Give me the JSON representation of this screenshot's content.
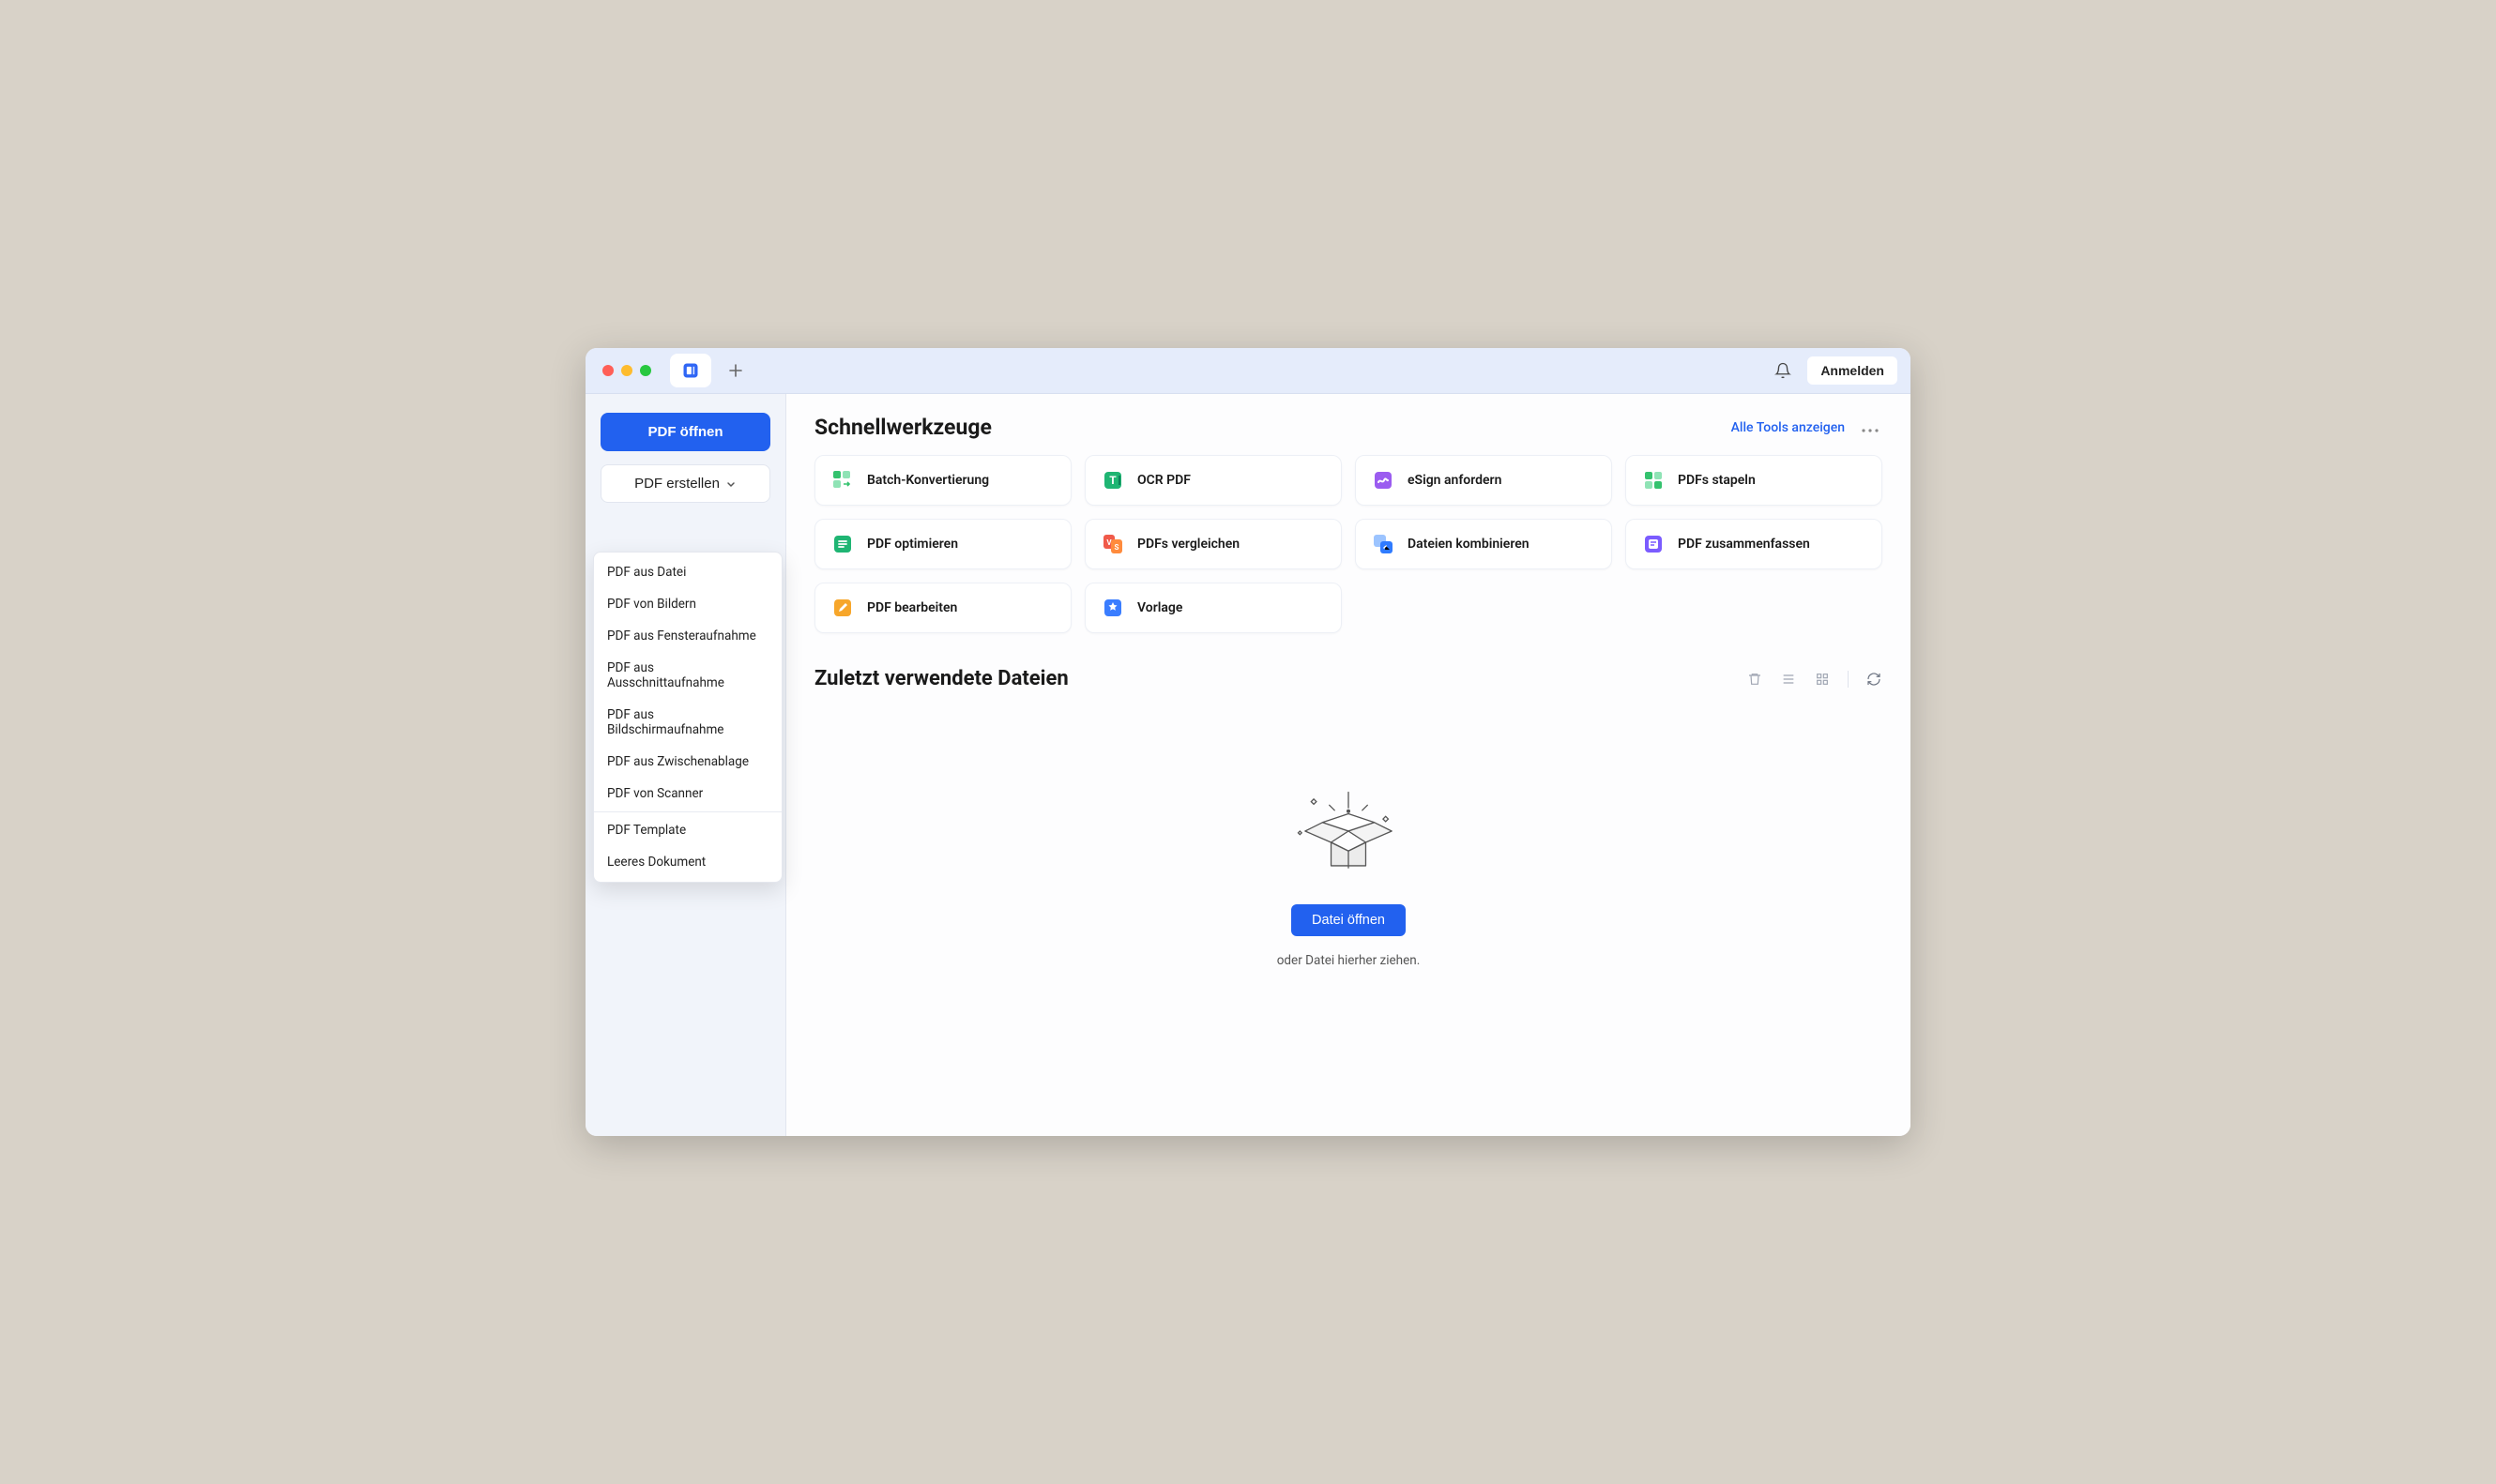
{
  "titlebar": {
    "login_label": "Anmelden"
  },
  "sidebar": {
    "open_pdf_label": "PDF öffnen",
    "create_pdf_label": "PDF erstellen",
    "create_menu": [
      "PDF aus Datei",
      "PDF von Bildern",
      "PDF aus Fensteraufnahme",
      "PDF aus Ausschnittaufnahme",
      "PDF aus Bildschirmaufnahme",
      "PDF aus Zwischenablage",
      "PDF von Scanner",
      "PDF Template",
      "Leeres Dokument"
    ]
  },
  "quicktools": {
    "title": "Schnellwerkzeuge",
    "show_all_label": "Alle Tools anzeigen",
    "tools": [
      {
        "label": "Batch-Konvertierung",
        "icon": "batch",
        "color": "#34c26e"
      },
      {
        "label": "OCR PDF",
        "icon": "ocr",
        "color": "#1fb573"
      },
      {
        "label": "eSign anfordern",
        "icon": "esign",
        "color": "#9b5cf0"
      },
      {
        "label": "PDFs stapeln",
        "icon": "stack",
        "color": "#34c26e"
      },
      {
        "label": "PDF optimieren",
        "icon": "optimize",
        "color": "#1fb573"
      },
      {
        "label": "PDFs vergleichen",
        "icon": "compare",
        "color": "#f05a4a"
      },
      {
        "label": "Dateien kombinieren",
        "icon": "combine",
        "color": "#2f7bff"
      },
      {
        "label": "PDF zusammenfassen",
        "icon": "summarize",
        "color": "#7b5cff"
      },
      {
        "label": "PDF bearbeiten",
        "icon": "edit",
        "color": "#f7a62a"
      },
      {
        "label": "Vorlage",
        "icon": "template",
        "color": "#3a7dff"
      }
    ]
  },
  "recent": {
    "title": "Zuletzt verwendete Dateien",
    "open_file_label": "Datei öffnen",
    "drop_hint": "oder Datei hierher ziehen."
  }
}
